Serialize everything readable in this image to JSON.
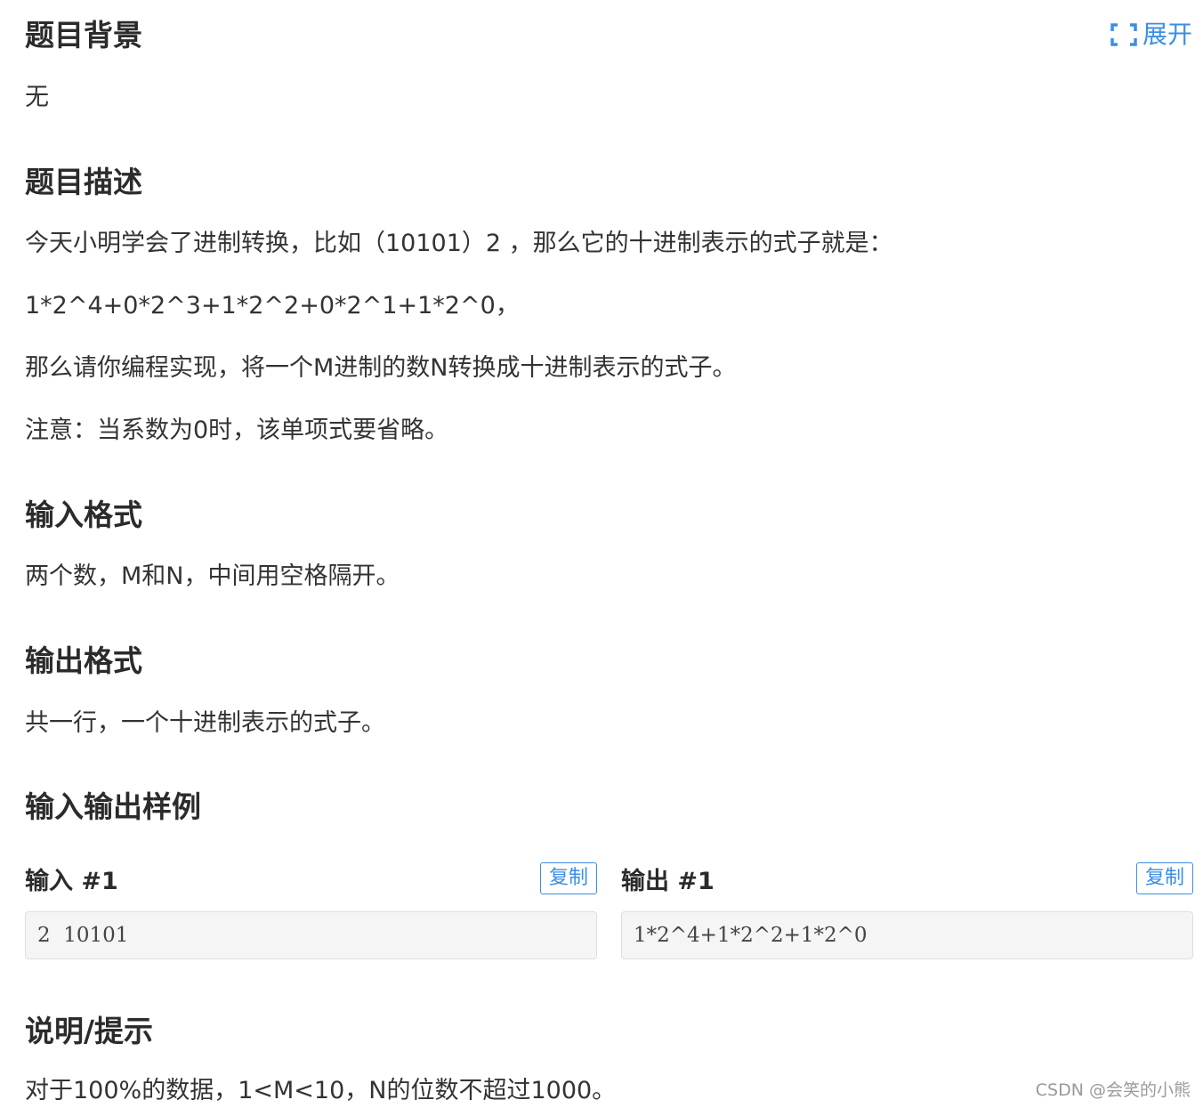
{
  "expand_label": "展开",
  "sections": {
    "background": {
      "title": "题目背景",
      "text": "无"
    },
    "description": {
      "title": "题目描述",
      "lines": [
        "今天小明学会了进制转换，比如（10101）2 ，那么它的十进制表示的式子就是：",
        "1*2^4+0*2^3+1*2^2+0*2^1+1*2^0，",
        "那么请你编程实现，将一个M进制的数N转换成十进制表示的式子。",
        "注意：当系数为0时，该单项式要省略。"
      ]
    },
    "input_format": {
      "title": "输入格式",
      "text": "两个数，M和N，中间用空格隔开。"
    },
    "output_format": {
      "title": "输出格式",
      "text": "共一行，一个十进制表示的式子。"
    },
    "samples": {
      "title": "输入输出样例",
      "input": {
        "label": "输入 #1",
        "copy_label": "复制",
        "content": "2  10101"
      },
      "output": {
        "label": "输出 #1",
        "copy_label": "复制",
        "content": "1*2^4+1*2^2+1*2^0"
      }
    },
    "hint": {
      "title": "说明/提示",
      "text": "对于100%的数据，1<M<10，N的位数不超过1000。"
    }
  },
  "watermark": "CSDN @会笑的小熊",
  "colors": {
    "accent": "#3a8ee6",
    "heading": "#2b2b2b",
    "body_text": "#333333",
    "code_bg": "#f5f5f5"
  }
}
